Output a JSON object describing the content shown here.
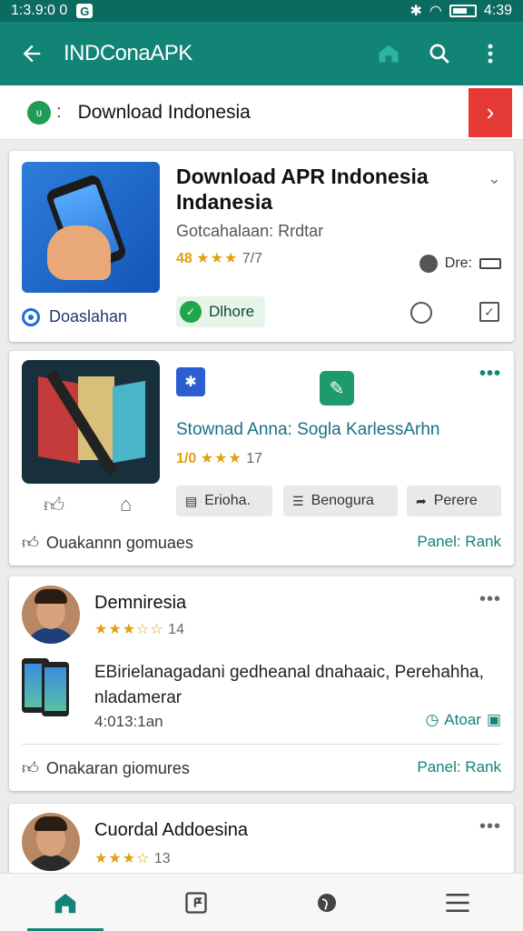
{
  "status_bar": {
    "time": "1:3.9:0 0",
    "clock": "4:39"
  },
  "app_bar": {
    "title": "INDConaAPK"
  },
  "banner": {
    "text": "Download Indonesia"
  },
  "card1": {
    "title": "Download APR Indonesia Indanesia",
    "subtitle": "Gotcahalaan: Rrdtar",
    "rating": "48",
    "stars": "★★★",
    "count": "7/7",
    "ram_label": "Dre:",
    "download_label": "Doaslahan",
    "install_label": "Dlhore"
  },
  "card2": {
    "title": "Stownad Anna: Sogla KarlessArhn",
    "rating": "1/0",
    "stars": "★★★",
    "count": "17",
    "chip1": "Erioha.",
    "chip2": "Benogura",
    "chip3": "Perere",
    "footer": "Ouakannn gomuaes",
    "rank": "Panel: Rank"
  },
  "card3": {
    "name": "Demniresia",
    "stars": "★★★☆☆",
    "count": "14",
    "description": "EBirielanagadani gedheanal dnahaaic, Perehahha, nladamerar",
    "time": "4:013:1an",
    "status": "Atoar",
    "footer": "Onakaran giomures",
    "rank": "Panel: Rank"
  },
  "card4": {
    "name": "Cuordal Addoesina",
    "stars": "★★★☆",
    "count": "13"
  },
  "colors": {
    "primary": "#128476",
    "status_bar": "#0b6b60",
    "accent_red": "#e53935",
    "star": "#e0a010"
  },
  "icons": {
    "back": "arrow-left-icon",
    "home": "home-icon",
    "search": "search-icon",
    "menu": "more-vert-icon",
    "nav": [
      "home-icon",
      "flag-icon",
      "globe-icon",
      "hamburger-menu-icon"
    ]
  }
}
